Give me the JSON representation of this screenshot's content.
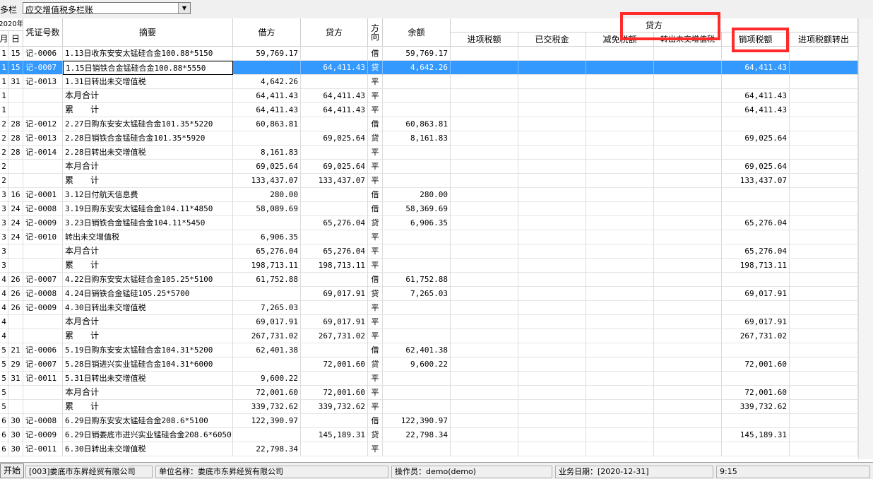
{
  "toolbar": {
    "label": "多栏",
    "select_value": "应交增值税多栏账"
  },
  "headers": {
    "year": "2020年",
    "month": "月",
    "day": "日",
    "voucher": "凭证号数",
    "summary": "摘要",
    "debit": "借方",
    "credit": "贷方",
    "direction": "方向",
    "balance": "余额",
    "credit_group": "贷方",
    "sub": [
      "进项税额",
      "已交税金",
      "减免税额",
      "转出未交增值税",
      "销项税额",
      "进项税额转出"
    ]
  },
  "rows": [
    {
      "m": "1",
      "d": "15",
      "v": "记-0006",
      "s": "1.13日收东安安太锰硅合金100.88*5150",
      "dr": "59,769.17",
      "cr": "",
      "dir": "借",
      "bal": "59,769.17",
      "out": ""
    },
    {
      "m": "1",
      "d": "15",
      "v": "记-0007",
      "s": "1.15日销铁合金锰硅合金100.88*5550",
      "dr": "",
      "cr": "64,411.43",
      "dir": "贷",
      "bal": "4,642.26",
      "out": "64,411.43",
      "selected": true
    },
    {
      "m": "1",
      "d": "31",
      "v": "记-0013",
      "s": "1.31日转出未交增值税",
      "dr": "4,642.26",
      "cr": "",
      "dir": "平",
      "bal": "",
      "out": ""
    },
    {
      "m": "1",
      "d": "",
      "v": "",
      "s": "本月合计",
      "dr": "64,411.43",
      "cr": "64,411.43",
      "dir": "平",
      "bal": "",
      "out": "64,411.43",
      "sum": true
    },
    {
      "m": "1",
      "d": "",
      "v": "",
      "s": "累　　计",
      "dr": "64,411.43",
      "cr": "64,411.43",
      "dir": "平",
      "bal": "",
      "out": "64,411.43",
      "sum": true
    },
    {
      "m": "2",
      "d": "28",
      "v": "记-0012",
      "s": "2.27日购东安安太锰硅合金101.35*5220",
      "dr": "60,863.81",
      "cr": "",
      "dir": "借",
      "bal": "60,863.81",
      "out": ""
    },
    {
      "m": "2",
      "d": "28",
      "v": "记-0013",
      "s": "2.28日销铁合金锰硅合金101.35*5920",
      "dr": "",
      "cr": "69,025.64",
      "dir": "贷",
      "bal": "8,161.83",
      "out": "69,025.64"
    },
    {
      "m": "2",
      "d": "28",
      "v": "记-0014",
      "s": "2.28日转出未交增值税",
      "dr": "8,161.83",
      "cr": "",
      "dir": "平",
      "bal": "",
      "out": ""
    },
    {
      "m": "2",
      "d": "",
      "v": "",
      "s": "本月合计",
      "dr": "69,025.64",
      "cr": "69,025.64",
      "dir": "平",
      "bal": "",
      "out": "69,025.64",
      "sum": true
    },
    {
      "m": "2",
      "d": "",
      "v": "",
      "s": "累　　计",
      "dr": "133,437.07",
      "cr": "133,437.07",
      "dir": "平",
      "bal": "",
      "out": "133,437.07",
      "sum": true
    },
    {
      "m": "3",
      "d": "16",
      "v": "记-0001",
      "s": "3.12日付航天信息费",
      "dr": "280.00",
      "cr": "",
      "dir": "借",
      "bal": "280.00",
      "out": ""
    },
    {
      "m": "3",
      "d": "24",
      "v": "记-0008",
      "s": "3.19日购东安安太锰硅合金104.11*4850",
      "dr": "58,089.69",
      "cr": "",
      "dir": "借",
      "bal": "58,369.69",
      "out": ""
    },
    {
      "m": "3",
      "d": "24",
      "v": "记-0009",
      "s": "3.23日销铁合金锰硅合金104.11*5450",
      "dr": "",
      "cr": "65,276.04",
      "dir": "贷",
      "bal": "6,906.35",
      "out": "65,276.04"
    },
    {
      "m": "3",
      "d": "24",
      "v": "记-0010",
      "s": "转出未交增值税",
      "dr": "6,906.35",
      "cr": "",
      "dir": "平",
      "bal": "",
      "out": ""
    },
    {
      "m": "3",
      "d": "",
      "v": "",
      "s": "本月合计",
      "dr": "65,276.04",
      "cr": "65,276.04",
      "dir": "平",
      "bal": "",
      "out": "65,276.04",
      "sum": true
    },
    {
      "m": "3",
      "d": "",
      "v": "",
      "s": "累　　计",
      "dr": "198,713.11",
      "cr": "198,713.11",
      "dir": "平",
      "bal": "",
      "out": "198,713.11",
      "sum": true
    },
    {
      "m": "4",
      "d": "26",
      "v": "记-0007",
      "s": "4.22日购东安安太锰硅合金105.25*5100",
      "dr": "61,752.88",
      "cr": "",
      "dir": "借",
      "bal": "61,752.88",
      "out": ""
    },
    {
      "m": "4",
      "d": "26",
      "v": "记-0008",
      "s": "4.24日销铁合金锰硅105.25*5700",
      "dr": "",
      "cr": "69,017.91",
      "dir": "贷",
      "bal": "7,265.03",
      "out": "69,017.91"
    },
    {
      "m": "4",
      "d": "26",
      "v": "记-0009",
      "s": "4.30日转出未交增值税",
      "dr": "7,265.03",
      "cr": "",
      "dir": "平",
      "bal": "",
      "out": ""
    },
    {
      "m": "4",
      "d": "",
      "v": "",
      "s": "本月合计",
      "dr": "69,017.91",
      "cr": "69,017.91",
      "dir": "平",
      "bal": "",
      "out": "69,017.91",
      "sum": true
    },
    {
      "m": "4",
      "d": "",
      "v": "",
      "s": "累　　计",
      "dr": "267,731.02",
      "cr": "267,731.02",
      "dir": "平",
      "bal": "",
      "out": "267,731.02",
      "sum": true
    },
    {
      "m": "5",
      "d": "21",
      "v": "记-0006",
      "s": "5.19日购东安安太锰硅合金104.31*5200",
      "dr": "62,401.38",
      "cr": "",
      "dir": "借",
      "bal": "62,401.38",
      "out": ""
    },
    {
      "m": "5",
      "d": "29",
      "v": "记-0007",
      "s": "5.28日销进兴实业锰硅合金104.31*6000",
      "dr": "",
      "cr": "72,001.60",
      "dir": "贷",
      "bal": "9,600.22",
      "out": "72,001.60"
    },
    {
      "m": "5",
      "d": "31",
      "v": "记-0011",
      "s": "5.31日转出未交增值税",
      "dr": "9,600.22",
      "cr": "",
      "dir": "平",
      "bal": "",
      "out": ""
    },
    {
      "m": "5",
      "d": "",
      "v": "",
      "s": "本月合计",
      "dr": "72,001.60",
      "cr": "72,001.60",
      "dir": "平",
      "bal": "",
      "out": "72,001.60",
      "sum": true
    },
    {
      "m": "5",
      "d": "",
      "v": "",
      "s": "累　　计",
      "dr": "339,732.62",
      "cr": "339,732.62",
      "dir": "平",
      "bal": "",
      "out": "339,732.62",
      "sum": true
    },
    {
      "m": "6",
      "d": "30",
      "v": "记-0008",
      "s": "6.29日购东安安太锰硅合金208.6*5100",
      "dr": "122,390.97",
      "cr": "",
      "dir": "借",
      "bal": "122,390.97",
      "out": ""
    },
    {
      "m": "6",
      "d": "30",
      "v": "记-0009",
      "s": "6.29日销娄底市进兴实业锰硅合金208.6*6050",
      "dr": "",
      "cr": "145,189.31",
      "dir": "贷",
      "bal": "22,798.34",
      "out": "145,189.31"
    },
    {
      "m": "6",
      "d": "30",
      "v": "记-0011",
      "s": "6.30日转出未交增值税",
      "dr": "22,798.34",
      "cr": "",
      "dir": "平",
      "bal": "",
      "out": ""
    }
  ],
  "statusbar": {
    "start": "开始",
    "company": "[003]娄底市东昇经贸有限公司",
    "unit": "单位名称：娄底市东昇经贸有限公司",
    "operator": "操作员：demo(demo)",
    "date": "业务日期：[2020-12-31]",
    "time": "9:15"
  }
}
